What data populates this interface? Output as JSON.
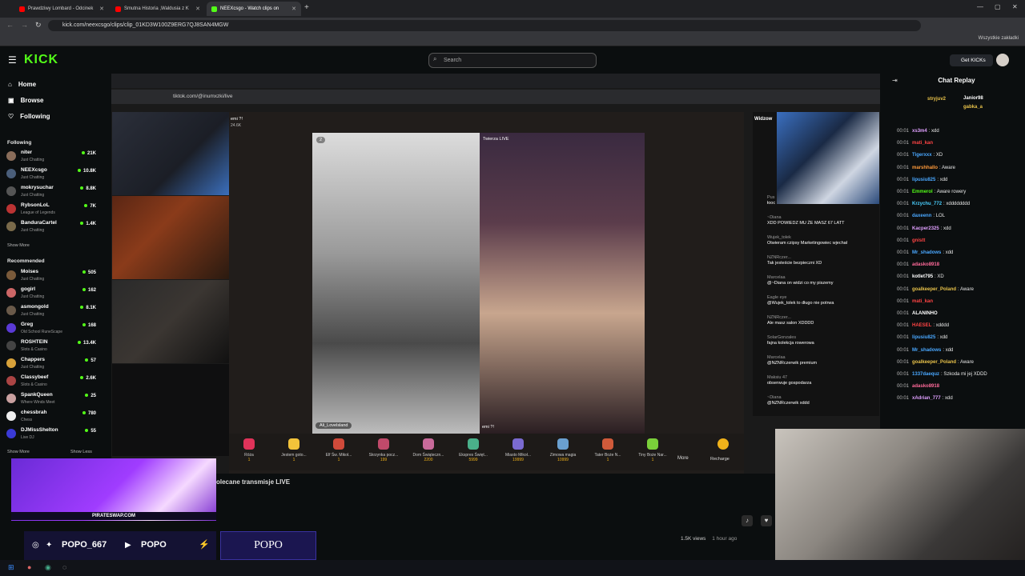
{
  "browser": {
    "tabs": [
      {
        "title": "Prawdziwy Lombard - Odcinek",
        "color": "#ff0000"
      },
      {
        "title": "Smutna Historia ,Waldusia z K",
        "color": "#ff0000"
      },
      {
        "title": "NEEXcsgo - Watch clips on",
        "color": "#53fc18"
      }
    ],
    "url": "kick.com/neexcsgo/clips/clip_01KD3W100Z9ERG7QJ8SAN4MGW",
    "bookmarks_label": "Wszystkie zakładki"
  },
  "header": {
    "logo": "KICK",
    "search_placeholder": "Search",
    "get_kicks": "Get KICKs"
  },
  "sidebar": {
    "nav": [
      "Home",
      "Browse",
      "Following"
    ],
    "following_title": "Following",
    "following": [
      {
        "name": "niter",
        "cat": "Just Chatting",
        "count": "21K",
        "color": "#8a6d5a"
      },
      {
        "name": "NEEXcsgo",
        "cat": "Just Chatting",
        "count": "10.8K",
        "color": "#4a5e7a"
      },
      {
        "name": "mokrysuchar",
        "cat": "Just Chatting",
        "count": "8.8K",
        "color": "#555"
      },
      {
        "name": "RybsonLoL",
        "cat": "League of Legends",
        "count": "7K",
        "color": "#b33"
      },
      {
        "name": "BanduraCartel",
        "cat": "Just Chatting",
        "count": "1.4K",
        "color": "#7a6a4a"
      }
    ],
    "show_more_1": "Show More",
    "recommended_title": "Recommended",
    "recommended": [
      {
        "name": "Moises",
        "cat": "Just Chatting",
        "count": "505",
        "color": "#7a5a3a"
      },
      {
        "name": "gogirl",
        "cat": "Just Chatting",
        "count": "162",
        "color": "#c66"
      },
      {
        "name": "asmongold",
        "cat": "Just Chatting",
        "count": "8.1K",
        "color": "#6a5a4a"
      },
      {
        "name": "Greg",
        "cat": "Old School RuneScape",
        "count": "168",
        "color": "#5a3ad6"
      },
      {
        "name": "ROSHTEIN",
        "cat": "Slots & Casino",
        "count": "13.4K",
        "color": "#444"
      },
      {
        "name": "Chappers",
        "cat": "Just Chatting",
        "count": "57",
        "color": "#d8a23a"
      },
      {
        "name": "Classybeef",
        "cat": "Slots & Casino",
        "count": "2.6K",
        "color": "#aa4444"
      },
      {
        "name": "SpankQueen",
        "cat": "Where Winds Meet",
        "count": "25",
        "color": "#c9a0a0"
      },
      {
        "name": "chessbrah",
        "cat": "Chess",
        "count": "780",
        "color": "#eee"
      },
      {
        "name": "DJMissShelton",
        "cat": "Live DJ",
        "count": "55",
        "color": "#3a3ad6"
      }
    ],
    "show_more_2": "Show More",
    "show_less": "Show Less"
  },
  "inner": {
    "url": "tiktok.com/@inumxzki/live",
    "host_name": "emi ?!",
    "host_followers": "24.6K",
    "badge_left": "2",
    "right_title": "Twierza LIVE",
    "left_label": "Ali_Lovelsland",
    "right_label": "emi ?!",
    "widzowie": "Widzow",
    "gifts": [
      {
        "name": "Róża",
        "price": "1"
      },
      {
        "name": "Jestem goto...",
        "price": "1"
      },
      {
        "name": "Elf Św. Mikoł...",
        "price": "1"
      },
      {
        "name": "Skrzynka pocz...",
        "price": "199"
      },
      {
        "name": "Dom Świąteczn...",
        "price": "2200"
      },
      {
        "name": "Ekspres Święt...",
        "price": "5999"
      },
      {
        "name": "Miasto Mikoł...",
        "price": "19999"
      },
      {
        "name": "Zimowa magia",
        "price": "10999"
      },
      {
        "name": "Tater Boże N...",
        "price": "1"
      },
      {
        "name": "Tiny Boże Nar...",
        "price": "1"
      }
    ],
    "more": "More",
    "recharge": "Recharge",
    "tt_messages": [
      {
        "u": "Pus",
        "m": "łooc"
      },
      {
        "u": "~Diana",
        "m": "XDD POWIEDZ MU ŻE MASZ 67 LATT"
      },
      {
        "u": "Wujek_tolek",
        "m": "Otwieram czipsy Marketingowiec wjechał"
      },
      {
        "u": "NZNRczer...",
        "m": "Tak jesteście bezpieczni XD"
      },
      {
        "u": "Marcelaa",
        "m": "@~Diana on widzi co my piszemy"
      },
      {
        "u": "Eagle eye",
        "m": "@Wujek_tolek to długo nie potrwa"
      },
      {
        "u": "NZNRczer...",
        "m": "Ale masz salon XDDDD"
      },
      {
        "u": "SolarGonzales",
        "m": "fajna kolekcja rowerowa"
      },
      {
        "u": "Marcelaa",
        "m": "@NZNRczerwik premium"
      },
      {
        "u": "Maksiu 47",
        "m": "obserwuje gospodarza"
      },
      {
        "u": "~Diana",
        "m": "@NZNRczerwik xddd"
      }
    ]
  },
  "chat": {
    "title": "Chat Replay",
    "top_users": [
      {
        "name": "stryjuv2",
        "color": "#e8c24a"
      },
      {
        "name": "Janior98",
        "color": "#fff"
      },
      {
        "name": "gabka_a",
        "color": "#e8c24a"
      }
    ],
    "messages": [
      {
        "t": "00:01",
        "u": "xs3m4",
        "c": "#e0a0ff",
        "m": ": xdd"
      },
      {
        "t": "00:01",
        "u": "mati_kan",
        "c": "#ff4444",
        "m": ""
      },
      {
        "t": "00:01",
        "u": "Tigerxxx",
        "c": "#4aa8ff",
        "m": ": XD"
      },
      {
        "t": "00:01",
        "u": "marshhallo",
        "c": "#ff9a3a",
        "m": ": Aware"
      },
      {
        "t": "00:01",
        "u": "lipusiu825",
        "c": "#4aa8ff",
        "m": ": xdd"
      },
      {
        "t": "00:01",
        "u": "Emmerol",
        "c": "#53fc18",
        "m": ": Aware rowery"
      },
      {
        "t": "00:01",
        "u": "Krzychu_772",
        "c": "#4ad0ff",
        "m": ": xdddddddd"
      },
      {
        "t": "00:01",
        "u": "daxeenn",
        "c": "#4aa8ff",
        "m": ": LOL"
      },
      {
        "t": "00:01",
        "u": "Kacper2325",
        "c": "#e0a0ff",
        "m": ": xdd"
      },
      {
        "t": "00:01",
        "u": "gnistt",
        "c": "#ff4444",
        "m": ""
      },
      {
        "t": "00:01",
        "u": "Mr_shadows",
        "c": "#4aa8ff",
        "m": ": xdd"
      },
      {
        "t": "00:01",
        "u": "adasko8918",
        "c": "#ff6a9a",
        "m": ""
      },
      {
        "t": "00:01",
        "u": "kotlet795",
        "c": "#ffffff",
        "m": ": XD"
      },
      {
        "t": "00:01",
        "u": "goalkeeper_Poland",
        "c": "#e8c24a",
        "m": ": Aware"
      },
      {
        "t": "00:01",
        "u": "mati_kan",
        "c": "#ff4444",
        "m": ""
      },
      {
        "t": "00:01",
        "u": "ALANINHO",
        "c": "#ffffff",
        "m": ""
      },
      {
        "t": "00:01",
        "u": "HAESEL",
        "c": "#ff4444",
        "m": ": xdddd"
      },
      {
        "t": "00:01",
        "u": "lipusiu825",
        "c": "#4aa8ff",
        "m": ": xdd"
      },
      {
        "t": "00:01",
        "u": "Mr_shadows",
        "c": "#4aa8ff",
        "m": ": xdd"
      },
      {
        "t": "00:01",
        "u": "goalkeeper_Poland",
        "c": "#e8c24a",
        "m": ": Aware"
      },
      {
        "t": "00:01",
        "u": "1337daequz",
        "c": "#4aa8ff",
        "m": ": Szkoda mi jej XDDD"
      },
      {
        "t": "00:01",
        "u": "adasko8918",
        "c": "#ff6a9a",
        "m": ""
      },
      {
        "t": "00:01",
        "u": "xAdrian_777",
        "c": "#e0a0ff",
        "m": ": xdd"
      }
    ]
  },
  "overlay": {
    "promo_site": "PIRATESWAP.COM",
    "recommended_label": "olecane transmisje LIVE",
    "social_handle": "POPO_667",
    "social_handle2": "POPO",
    "popo_box": "POPO",
    "views": "1.5K views",
    "ago": "1 hour ago"
  }
}
